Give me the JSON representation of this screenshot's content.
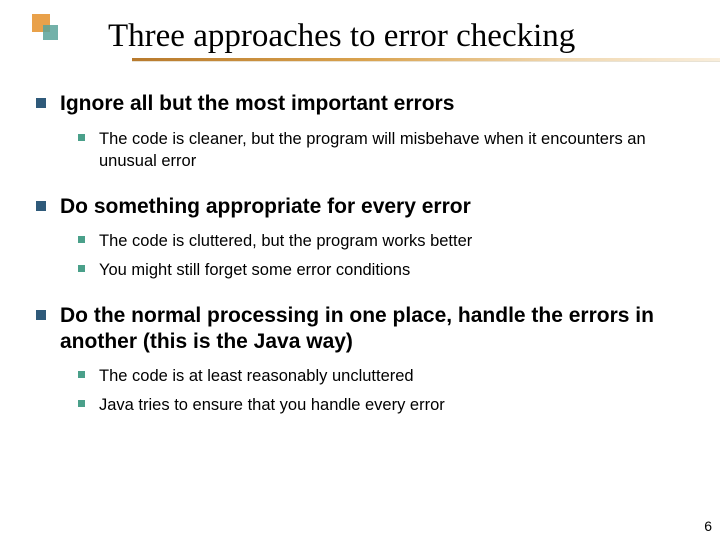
{
  "slide": {
    "title": "Three approaches to error checking",
    "pageNumber": "6",
    "items": [
      {
        "text": "Ignore all but the most important errors",
        "sub": [
          "The code is cleaner, but the program will misbehave when it encounters an unusual error"
        ]
      },
      {
        "text": "Do something appropriate for every error",
        "sub": [
          "The code is cluttered, but the program works better",
          "You might still forget some error conditions"
        ]
      },
      {
        "text": "Do the normal processing in one place, handle the errors in another (this is the Java way)",
        "sub": [
          "The code is at least reasonably uncluttered",
          "Java tries to ensure that you handle every error"
        ]
      }
    ]
  }
}
